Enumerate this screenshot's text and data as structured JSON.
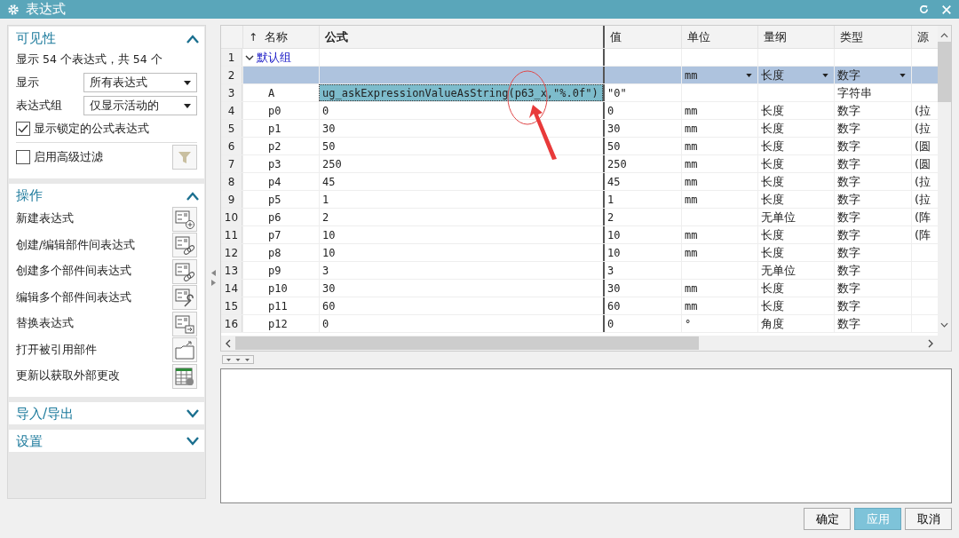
{
  "window": {
    "title": "表达式"
  },
  "left_panel": {
    "sections": [
      {
        "kind": "visibility",
        "title": "可见性",
        "expanded": true,
        "summary": "显示 54 个表达式，共 54 个",
        "fields": [
          {
            "label": "显示",
            "value": "所有表达式"
          },
          {
            "label": "表达式组",
            "value": "仅显示活动的"
          }
        ],
        "checkboxes": [
          {
            "label": "显示锁定的公式表达式",
            "checked": true
          },
          {
            "label": "启用高级过滤",
            "checked": false
          }
        ]
      },
      {
        "kind": "operations",
        "title": "操作",
        "expanded": true,
        "items": [
          "新建表达式",
          "创建/编辑部件间表达式",
          "创建多个部件间表达式",
          "编辑多个部件间表达式",
          "替换表达式",
          "打开被引用部件",
          "更新以获取外部更改"
        ]
      },
      {
        "kind": "collapsed",
        "title": "导入/导出",
        "expanded": false
      },
      {
        "kind": "collapsed",
        "title": "设置",
        "expanded": false
      }
    ]
  },
  "table": {
    "sort_indicator": "↑",
    "columns": [
      "名称",
      "公式",
      "值",
      "单位",
      "量纲",
      "类型",
      "源"
    ],
    "rows": [
      {
        "number": "1",
        "kind": "group",
        "name": "默认组",
        "expanded": true
      },
      {
        "number": "2",
        "kind": "edit",
        "unit": "mm",
        "dimension": "长度",
        "type": "数字"
      },
      {
        "number": "3",
        "kind": "expression",
        "name": "A",
        "formula": "ug_askExpressionValueAsString(p63_x,\"%.0f\")",
        "value": "\"0\"",
        "type": "字符串",
        "selected": true
      },
      {
        "number": "4",
        "kind": "expression",
        "name": "p0",
        "formula": "0",
        "value": "0",
        "unit": "mm",
        "dimension": "长度",
        "type": "数字",
        "source": "(拉",
        "selected": false
      },
      {
        "number": "5",
        "kind": "expression",
        "name": "p1",
        "formula": "30",
        "value": "30",
        "unit": "mm",
        "dimension": "长度",
        "type": "数字",
        "source": "(拉",
        "selected": false
      },
      {
        "number": "6",
        "kind": "expression",
        "name": "p2",
        "formula": "50",
        "value": "50",
        "unit": "mm",
        "dimension": "长度",
        "type": "数字",
        "source": "(圆",
        "selected": false
      },
      {
        "number": "7",
        "kind": "expression",
        "name": "p3",
        "formula": "250",
        "value": "250",
        "unit": "mm",
        "dimension": "长度",
        "type": "数字",
        "source": "(圆",
        "selected": false
      },
      {
        "number": "8",
        "kind": "expression",
        "name": "p4",
        "formula": "45",
        "value": "45",
        "unit": "mm",
        "dimension": "长度",
        "type": "数字",
        "source": "(拉",
        "selected": false
      },
      {
        "number": "9",
        "kind": "expression",
        "name": "p5",
        "formula": "1",
        "value": "1",
        "unit": "mm",
        "dimension": "长度",
        "type": "数字",
        "source": "(拉",
        "selected": false
      },
      {
        "number": "10",
        "kind": "expression",
        "name": "p6",
        "formula": "2",
        "value": "2",
        "dimension": "无单位",
        "type": "数字",
        "source": "(阵",
        "selected": false
      },
      {
        "number": "11",
        "kind": "expression",
        "name": "p7",
        "formula": "10",
        "value": "10",
        "unit": "mm",
        "dimension": "长度",
        "type": "数字",
        "source": "(阵",
        "selected": false
      },
      {
        "number": "12",
        "kind": "expression",
        "name": "p8",
        "formula": "10",
        "value": "10",
        "unit": "mm",
        "dimension": "长度",
        "type": "数字",
        "selected": false
      },
      {
        "number": "13",
        "kind": "expression",
        "name": "p9",
        "formula": "3",
        "value": "3",
        "dimension": "无单位",
        "type": "数字",
        "selected": false
      },
      {
        "number": "14",
        "kind": "expression",
        "name": "p10",
        "formula": "30",
        "value": "30",
        "unit": "mm",
        "dimension": "长度",
        "type": "数字",
        "selected": false
      },
      {
        "number": "15",
        "kind": "expression",
        "name": "p11",
        "formula": "60",
        "value": "60",
        "unit": "mm",
        "dimension": "长度",
        "type": "数字",
        "selected": false
      },
      {
        "number": "16",
        "kind": "expression",
        "name": "p12",
        "formula": "0",
        "value": "0",
        "unit": "°",
        "dimension": "角度",
        "type": "数字",
        "selected": false
      }
    ]
  },
  "buttons": [
    {
      "label": "确定",
      "kind": "normal"
    },
    {
      "label": "应用",
      "kind": "primary"
    },
    {
      "label": "取消",
      "kind": "normal"
    }
  ]
}
